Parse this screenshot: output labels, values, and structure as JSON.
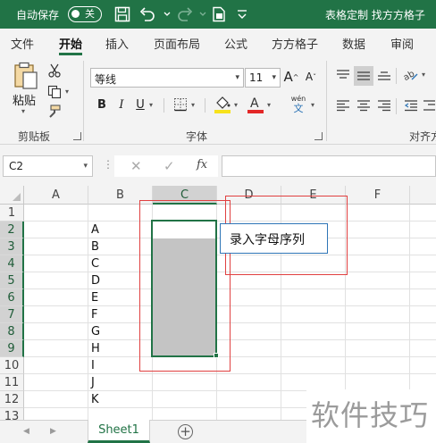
{
  "titlebar": {
    "autosave_label": "自动保存",
    "autosave_state": "关",
    "doc_title": "表格定制 找方方格子",
    "icons": [
      "save-icon",
      "undo-icon",
      "redo-icon",
      "new-doc-icon",
      "more-icon"
    ]
  },
  "tabs": [
    "文件",
    "开始",
    "插入",
    "页面布局",
    "公式",
    "方方格子",
    "数据",
    "审阅"
  ],
  "active_tab": "开始",
  "ribbon": {
    "clipboard": {
      "paste_label": "粘贴",
      "group_label": "剪贴板"
    },
    "font": {
      "font_name": "等线",
      "font_size": "11",
      "bold": "B",
      "italic": "I",
      "underline": "U",
      "phonetic_top": "wén",
      "phonetic_bottom": "文",
      "group_label": "字体",
      "font_color": "#e32727",
      "fill_color": "#f7e21c"
    },
    "alignment": {
      "group_label": "对齐方"
    }
  },
  "formula_bar": {
    "name_box": "C2",
    "fx": "fx",
    "formula": ""
  },
  "grid": {
    "columns": [
      "A",
      "B",
      "C",
      "D",
      "E",
      "F"
    ],
    "rows": [
      "1",
      "2",
      "3",
      "4",
      "5",
      "6",
      "7",
      "8",
      "9",
      "10",
      "11",
      "12",
      "13"
    ],
    "column_b_values": [
      "",
      "A",
      "B",
      "C",
      "D",
      "E",
      "F",
      "G",
      "H",
      "I",
      "J",
      "K",
      ""
    ],
    "note_text": "录入字母序列",
    "selected_column": "C",
    "selected_range": "C2:C9"
  },
  "sheets": [
    "Sheet1"
  ],
  "active_sheet": "Sheet1",
  "watermark": "软件技巧",
  "colors": {
    "brand_green": "#217346",
    "annotation_red": "#e04040",
    "note_border": "#2e75b6"
  }
}
